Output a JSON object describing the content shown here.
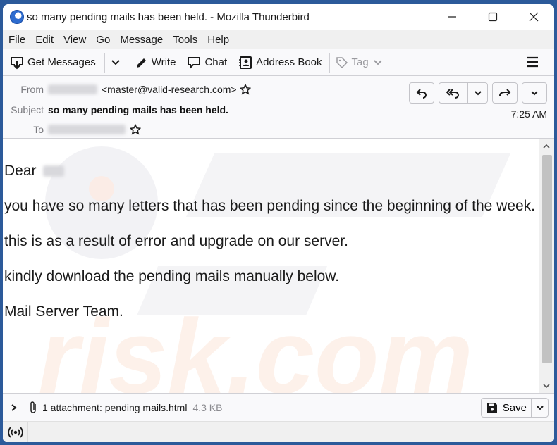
{
  "window": {
    "title": "so many pending mails has been held. - Mozilla Thunderbird",
    "controls": [
      "minimize-icon",
      "maximize-icon",
      "close-icon"
    ]
  },
  "menubar": {
    "items": [
      {
        "label": "File",
        "accel": "F"
      },
      {
        "label": "Edit",
        "accel": "E"
      },
      {
        "label": "View",
        "accel": "V"
      },
      {
        "label": "Go",
        "accel": "G"
      },
      {
        "label": "Message",
        "accel": "M"
      },
      {
        "label": "Tools",
        "accel": "T"
      },
      {
        "label": "Help",
        "accel": "H"
      }
    ]
  },
  "toolbar": {
    "get_messages": "Get Messages",
    "write": "Write",
    "chat": "Chat",
    "address_book": "Address Book",
    "tag": "Tag"
  },
  "header": {
    "from_label": "From",
    "from_email": "<master@valid-research.com>",
    "subject_label": "Subject",
    "subject": "so many pending mails has been held.",
    "to_label": "To",
    "time": "7:25 AM"
  },
  "body": {
    "greeting": "Dear",
    "lines": [
      "you have so many letters that has been pending since the beginning of the week.",
      "this is as a result of error and upgrade on our server.",
      "kindly download the pending mails manually below.",
      "Mail Server Team."
    ]
  },
  "attachments": {
    "summary": "1 attachment: pending mails.html",
    "size": "4.3 KB",
    "save_label": "Save"
  },
  "colors": {
    "accent": "#2c5a9a",
    "watermark": "#f2f2f4"
  }
}
